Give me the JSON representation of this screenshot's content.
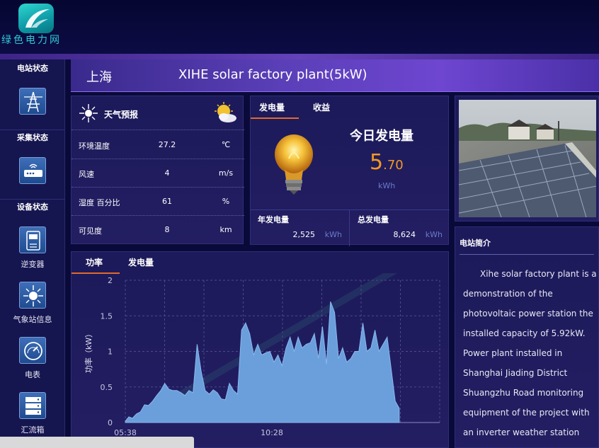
{
  "brand": {
    "logo_text": "绿色电力网"
  },
  "sidebar": {
    "sections": [
      {
        "heading": "电站状态",
        "icon": "power-tower-icon"
      },
      {
        "heading": "采集状态",
        "icon": "router-icon"
      },
      {
        "heading": "设备状态",
        "icon": ""
      }
    ],
    "devices": [
      {
        "label": "逆变器",
        "icon": "inverter-icon"
      },
      {
        "label": "气象站信息",
        "icon": "weather-station-icon"
      },
      {
        "label": "电表",
        "icon": "meter-icon"
      },
      {
        "label": "汇流箱",
        "icon": "combiner-box-icon"
      }
    ]
  },
  "station": {
    "city": "上海",
    "name": "XIHE solar factory plant(5kW)"
  },
  "weather": {
    "title": "天气预报",
    "rows": [
      {
        "label": "环境温度",
        "value": "27.2",
        "unit": "℃"
      },
      {
        "label": "风速",
        "value": "4",
        "unit": "m/s"
      },
      {
        "label": "湿度 百分比",
        "value": "61",
        "unit": "%"
      },
      {
        "label": "可见度",
        "value": "8",
        "unit": "km"
      }
    ]
  },
  "generation": {
    "tabs": [
      "发电量",
      "收益"
    ],
    "today_title": "今日发电量",
    "today_int": "5",
    "today_dec": ".70",
    "today_unit": "kWh",
    "yearly_title": "年发电量",
    "yearly_value": "2,525",
    "yearly_unit": "kWh",
    "total_title": "总发电量",
    "total_value": "8,624",
    "total_unit": "kWh"
  },
  "intro": {
    "title": "电站简介",
    "text": "Xihe solar factory plant is a demonstration of the photovoltaic power station the installed capacity of 5.92kW. Power plant installed in Shanghai Jiading District Shuangzhu Road monitoring equipment of the project with an inverter weather station and electric meter"
  },
  "colors": {
    "accent_orange": "#f39a22",
    "tab_underline": "#e06a2a",
    "area_fill": "#6a9fdb"
  },
  "chart_data": {
    "type": "area",
    "tabs": [
      "功率",
      "发电量"
    ],
    "ylabel": "功率（kW）",
    "xlabel": "",
    "ylim": [
      0,
      2
    ],
    "yticks": [
      "0",
      "0.5",
      "1",
      "1.5",
      "2"
    ],
    "xtick_labels": [
      "05:38",
      "10:28"
    ],
    "x_range_minutes": [
      338,
      960
    ],
    "x": [
      338,
      345,
      352,
      360,
      368,
      376,
      384,
      392,
      400,
      408,
      416,
      424,
      432,
      440,
      448,
      456,
      464,
      472,
      480,
      488,
      496,
      504,
      512,
      520,
      528,
      536,
      544,
      552,
      560,
      568,
      576,
      584,
      592,
      600,
      608,
      616,
      624,
      632,
      640,
      648,
      656,
      664,
      672,
      680,
      688,
      696,
      704,
      712,
      720,
      728,
      736,
      744,
      752,
      760,
      768,
      776,
      784,
      792,
      800,
      808,
      816,
      824,
      832,
      840,
      848,
      856,
      864,
      872,
      880
    ],
    "values": [
      0.02,
      0.08,
      0.06,
      0.12,
      0.15,
      0.25,
      0.24,
      0.3,
      0.38,
      0.45,
      0.55,
      0.47,
      0.45,
      0.45,
      0.42,
      0.38,
      0.45,
      0.42,
      1.1,
      0.72,
      0.45,
      0.4,
      0.46,
      0.42,
      0.33,
      0.32,
      0.55,
      0.45,
      0.4,
      1.3,
      1.4,
      1.25,
      0.95,
      1.1,
      0.95,
      0.98,
      1.0,
      0.85,
      0.95,
      0.8,
      1.05,
      1.2,
      1.0,
      1.2,
      1.05,
      1.1,
      1.12,
      1.25,
      0.9,
      1.35,
      0.82,
      1.7,
      1.55,
      0.9,
      1.05,
      0.85,
      0.9,
      1.0,
      1.0,
      1.4,
      1.0,
      1.05,
      1.3,
      1.0,
      1.1,
      1.2,
      0.75,
      0.3,
      0.2
    ]
  }
}
